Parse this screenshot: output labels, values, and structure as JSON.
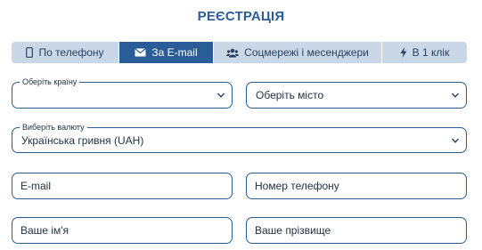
{
  "title": "РЕЄСТРАЦІЯ",
  "tabs": [
    {
      "label": "По телефону",
      "icon": "phone-icon",
      "active": false
    },
    {
      "label": "За E-mail",
      "icon": "envelope-icon",
      "active": true
    },
    {
      "label": "Соцмережі і месенджери",
      "icon": "users-icon",
      "active": false
    },
    {
      "label": "В 1 клік",
      "icon": "lightning-icon",
      "active": false
    }
  ],
  "country": {
    "legend": "Оберіть країну",
    "value": ""
  },
  "city": {
    "value": "Оберіть місто"
  },
  "currency": {
    "legend": "Виберіть валюту",
    "value": "Українська гривня (UAH)"
  },
  "email": {
    "placeholder": "E-mail"
  },
  "phone": {
    "placeholder": "Номер телефону"
  },
  "first_name": {
    "placeholder": "Ваше ім'я"
  },
  "last_name": {
    "placeholder": "Ваше прізвище"
  },
  "colors": {
    "accent": "#2a5d97",
    "tab_bg": "#c9d7e6"
  }
}
